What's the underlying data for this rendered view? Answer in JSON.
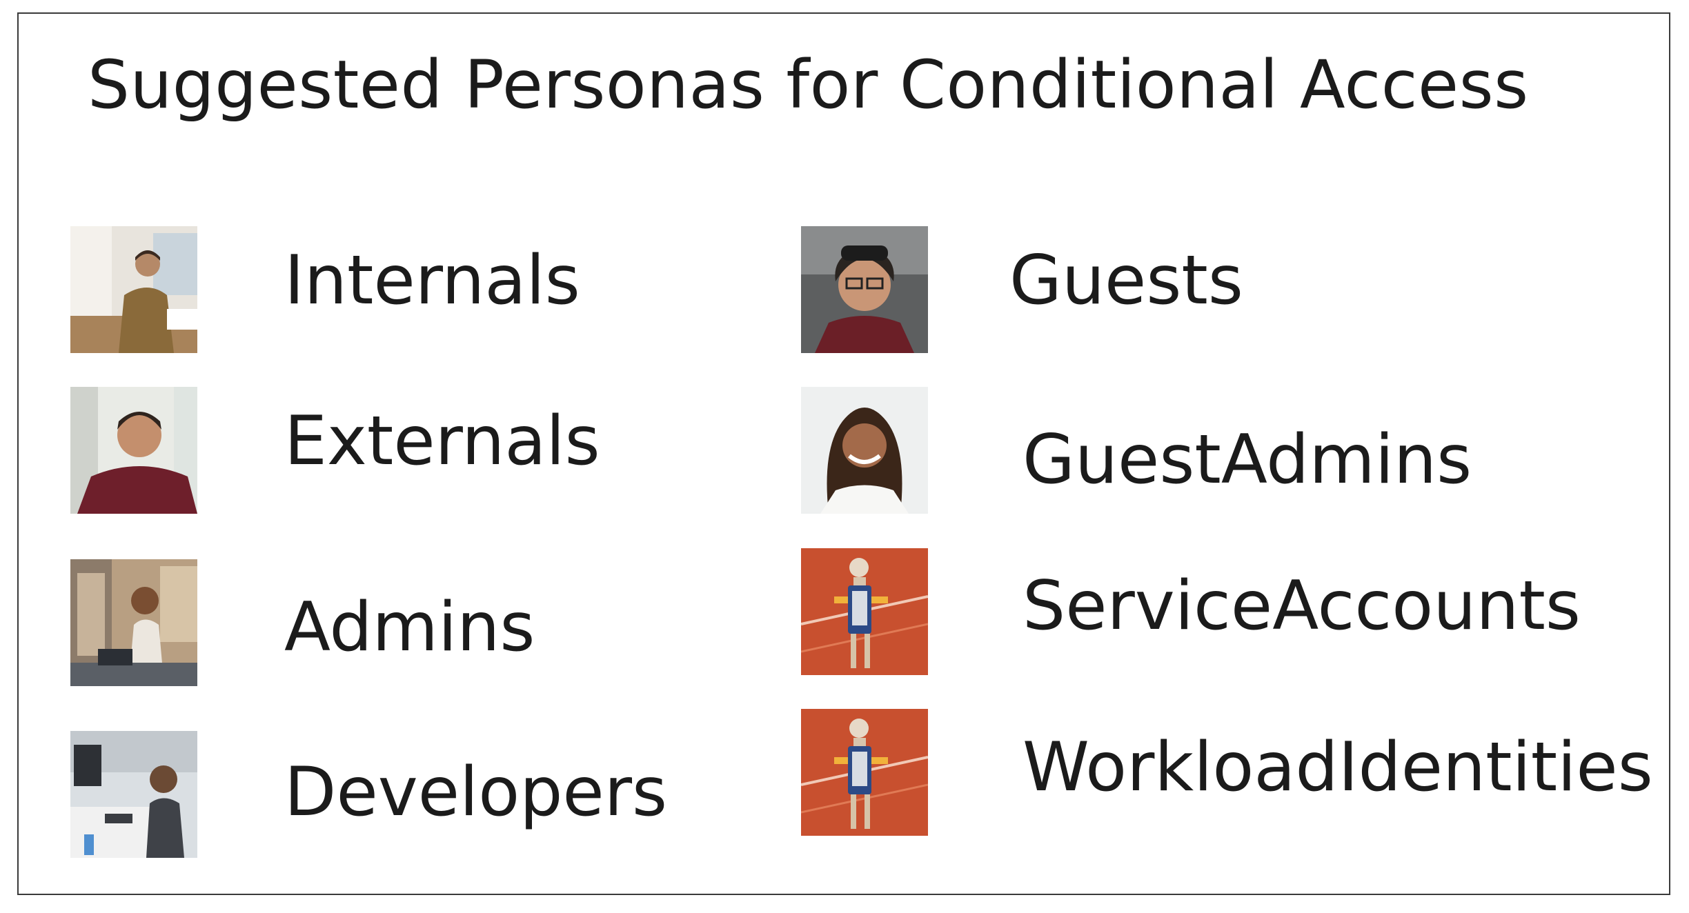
{
  "slide": {
    "title": "Suggested Personas for Conditional Access"
  },
  "personas": [
    {
      "label": "Internals",
      "image": "person-photo-icon"
    },
    {
      "label": "Externals",
      "image": "person-photo-icon"
    },
    {
      "label": "Admins",
      "image": "person-photo-icon"
    },
    {
      "label": "Developers",
      "image": "person-photo-icon"
    },
    {
      "label": "Guests",
      "image": "person-photo-icon"
    },
    {
      "label": "GuestAdmins",
      "image": "person-photo-icon"
    },
    {
      "label": "ServiceAccounts",
      "image": "robot-photo-icon"
    },
    {
      "label": "WorkloadIdentities",
      "image": "robot-photo-icon"
    }
  ],
  "colors": {
    "text": "#1b1b1b",
    "border": "#3a3a3a",
    "robot_background": "#c8502f"
  }
}
